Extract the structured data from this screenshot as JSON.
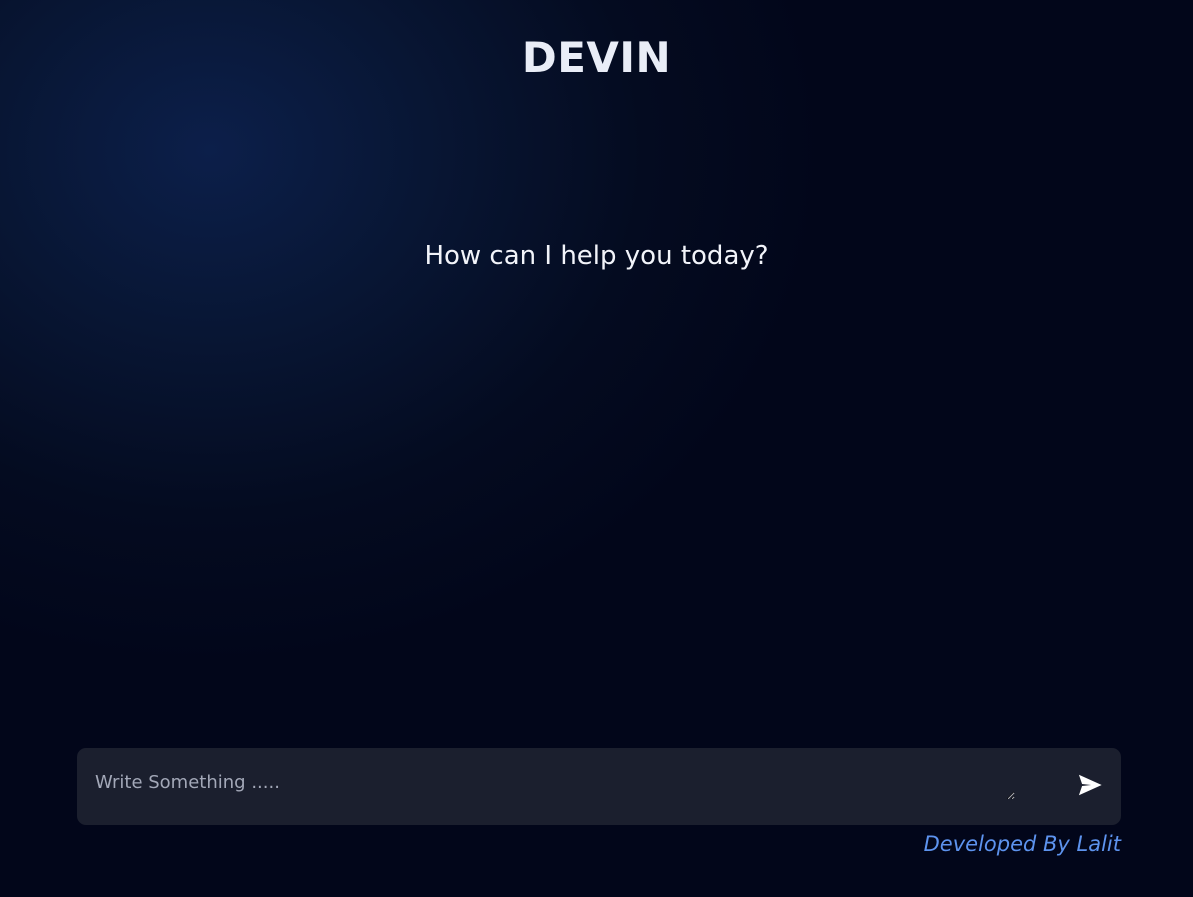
{
  "header": {
    "title": "DEVIN"
  },
  "main": {
    "greeting": "How can I help you today?"
  },
  "composer": {
    "placeholder": "Write Something .....",
    "value": "",
    "send_icon": "send-icon"
  },
  "footer": {
    "credit": "Developed By Lalit"
  },
  "colors": {
    "background": "#040b20",
    "input_background": "#1b1f2e",
    "accent_link": "#5d93ee",
    "title": "#e9edf7"
  }
}
